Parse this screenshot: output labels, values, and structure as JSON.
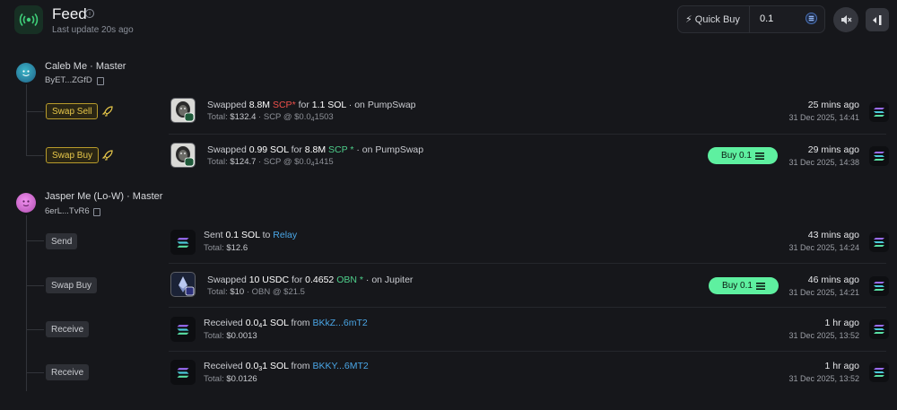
{
  "header": {
    "title": "Feed",
    "info_icon": "info-icon",
    "last_update": "Last update 20s ago",
    "quick_buy_label": "⚡ Quick Buy",
    "quick_buy_value": "0.1",
    "colors": {
      "accent_green": "#5ef0a0",
      "live_icon": "#3fcf7a"
    }
  },
  "accounts": [
    {
      "name": "Caleb Me · Master",
      "address": "ByET...ZGfD",
      "avatar_color": "#2a7fa0",
      "transactions": [
        {
          "action": "Swap Sell",
          "action_style": "yellow",
          "main": {
            "p1": "Swapped ",
            "amount1": "8.8M",
            "token1": "SCP",
            "p2": " for ",
            "amount2": "1.1 SOL",
            "p3": " · on PumpSwap"
          },
          "sub": {
            "total_label": "Total: ",
            "total": "$132.4",
            "rest": " · SCP @ $0.0",
            "sub_digit": "4",
            "tail": "1503"
          },
          "time_ago": "25 mins ago",
          "date": "31 Dec 2025, 14:41"
        },
        {
          "action": "Swap Buy",
          "action_style": "yellow",
          "main": {
            "p1": "Swapped ",
            "amount1": "0.99 SOL",
            "p2": " for ",
            "amount2": "8.8M",
            "token2": "SCP",
            "p3": " · on PumpSwap"
          },
          "sub": {
            "total_label": "Total: ",
            "total": "$124.7",
            "rest": " · SCP @ $0.0",
            "sub_digit": "4",
            "tail": "1415"
          },
          "buy_label": "Buy 0.1",
          "time_ago": "29 mins ago",
          "date": "31 Dec 2025, 14:38"
        }
      ]
    },
    {
      "name": "Jasper Me (Lo-W) · Master",
      "address": "6erL...TvR6",
      "avatar_color": "#d76ad6",
      "transactions": [
        {
          "action": "Send",
          "main": {
            "p1": "Sent ",
            "amount1": "0.1 SOL",
            "p2": " to ",
            "link": "Relay"
          },
          "sub": {
            "total_label": "Total: ",
            "total": "$12.6"
          },
          "time_ago": "43 mins ago",
          "date": "31 Dec 2025, 14:24"
        },
        {
          "action": "Swap Buy",
          "main": {
            "p1": "Swapped ",
            "amount1": "10 USDC",
            "p2": " for ",
            "amount2": "0.4652",
            "token2": "OBN",
            "p3": " · on Jupiter"
          },
          "sub": {
            "total_label": "Total: ",
            "total": "$10",
            "rest": " · OBN @ $21.5"
          },
          "buy_label": "Buy 0.1",
          "time_ago": "46 mins ago",
          "date": "31 Dec 2025, 14:21"
        },
        {
          "action": "Receive",
          "main": {
            "p1": "Received ",
            "amount_a": "0.0",
            "amount_sub": "4",
            "amount_b": "1 SOL",
            "p2": " from ",
            "link": "BKkZ...6mT2"
          },
          "sub": {
            "total_label": "Total: ",
            "total": "$0.0013"
          },
          "time_ago": "1 hr ago",
          "date": "31 Dec 2025, 13:52"
        },
        {
          "action": "Receive",
          "main": {
            "p1": "Received ",
            "amount_a": "0.0",
            "amount_sub": "3",
            "amount_b": "1 SOL",
            "p2": " from ",
            "link": "BKKY...6MT2"
          },
          "sub": {
            "total_label": "Total: ",
            "total": "$0.0126"
          },
          "time_ago": "1 hr ago",
          "date": "31 Dec 2025, 13:52"
        }
      ]
    }
  ]
}
